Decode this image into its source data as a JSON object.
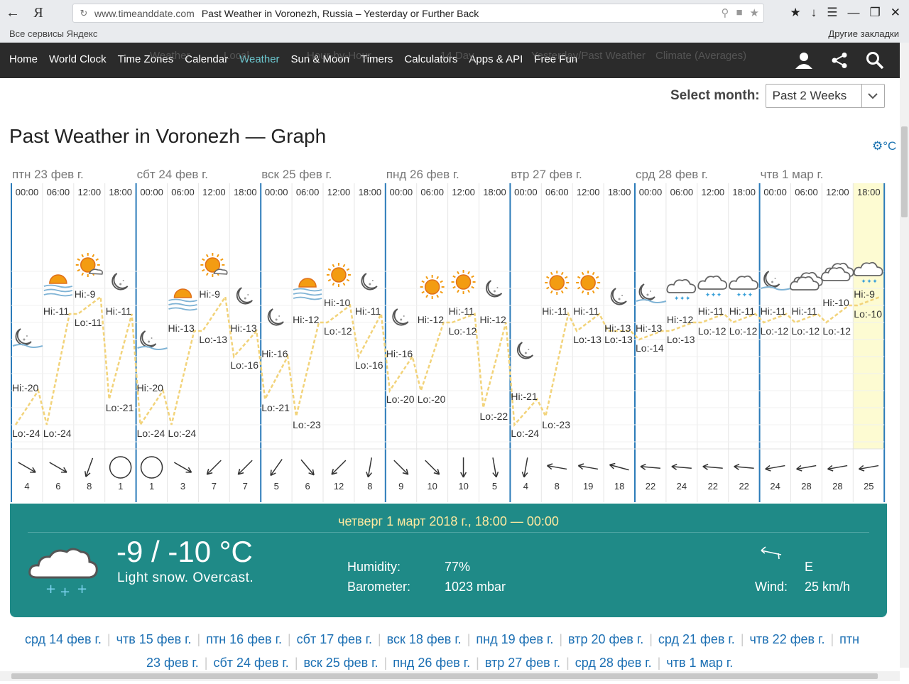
{
  "browser": {
    "url_domain": "www.timeanddate.com",
    "tab_title": "Past Weather in Voronezh, Russia – Yesterday or Further Back",
    "bookmarks_left": "Все сервисы Яндекс",
    "bookmarks_right": "Другие закладки"
  },
  "nav": {
    "items": [
      "Home",
      "World Clock",
      "Time Zones",
      "Calendar",
      "Weather",
      "Sun & Moon",
      "Timers",
      "Calculators",
      "Apps & API",
      "Free Fun"
    ],
    "active": "Weather",
    "subnav_ghost": [
      "Weather",
      "Local",
      "Hour-by-Hour",
      "14 Day",
      "Yesterday/Past Weather",
      "Climate (Averages)"
    ]
  },
  "month_select": {
    "label": "Select month:",
    "value": "Past 2 Weeks"
  },
  "page_title": "Past Weather in Voronezh — Graph",
  "unit_toggle": "°C",
  "graph": {
    "days": [
      "птн 23 фев г.",
      "сбт 24 фев г.",
      "вск 25 фев г.",
      "пнд 26 фев г.",
      "втр 27 фев г.",
      "срд 28 фев г.",
      "чтв 1 мар г."
    ],
    "hours": [
      "00:00",
      "06:00",
      "12:00",
      "18:00"
    ],
    "slots": [
      {
        "icon": "night-partly-cloudy",
        "hi": "Hi:-20",
        "lo": "Lo:-24",
        "wind_dir": 120,
        "wind": "4"
      },
      {
        "icon": "sunrise-fog",
        "hi": "Hi:-11",
        "lo": "Lo:-24",
        "wind_dir": 120,
        "wind": "6"
      },
      {
        "icon": "sun-cloud",
        "hi": "Hi:-9",
        "lo": "Lo:-11",
        "wind_dir": 200,
        "wind": "8"
      },
      {
        "icon": "moon",
        "hi": "Hi:-11",
        "lo": "Lo:-21",
        "wind_dir": -1,
        "wind": "1"
      },
      {
        "icon": "night-partly-cloudy",
        "hi": "Hi:-20",
        "lo": "Lo:-24",
        "wind_dir": -1,
        "wind": "1"
      },
      {
        "icon": "sunrise-fog",
        "hi": "Hi:-13",
        "lo": "Lo:-24",
        "wind_dir": 120,
        "wind": "3"
      },
      {
        "icon": "sun-cloud",
        "hi": "Hi:-9",
        "lo": "Lo:-13",
        "wind_dir": 225,
        "wind": "7"
      },
      {
        "icon": "moon",
        "hi": "Hi:-13",
        "lo": "Lo:-16",
        "wind_dir": 225,
        "wind": "7"
      },
      {
        "icon": "moon",
        "hi": "Hi:-16",
        "lo": "Lo:-21",
        "wind_dir": 215,
        "wind": "5"
      },
      {
        "icon": "sunrise-fog",
        "hi": "Hi:-12",
        "lo": "Lo:-23",
        "wind_dir": 140,
        "wind": "6"
      },
      {
        "icon": "sun",
        "hi": "Hi:-10",
        "lo": "Lo:-12",
        "wind_dir": 225,
        "wind": "12"
      },
      {
        "icon": "moon",
        "hi": "Hi:-11",
        "lo": "Lo:-16",
        "wind_dir": 190,
        "wind": "8"
      },
      {
        "icon": "moon",
        "hi": "Hi:-16",
        "lo": "Lo:-20",
        "wind_dir": 135,
        "wind": "9"
      },
      {
        "icon": "sun",
        "hi": "Hi:-12",
        "lo": "Lo:-20",
        "wind_dir": 135,
        "wind": "10"
      },
      {
        "icon": "sun",
        "hi": "Hi:-11",
        "lo": "Lo:-12",
        "wind_dir": 180,
        "wind": "10"
      },
      {
        "icon": "moon",
        "hi": "Hi:-12",
        "lo": "Lo:-22",
        "wind_dir": 170,
        "wind": "5"
      },
      {
        "icon": "moon",
        "hi": "Hi:-21",
        "lo": "Lo:-24",
        "wind_dir": 190,
        "wind": "4"
      },
      {
        "icon": "sun",
        "hi": "Hi:-11",
        "lo": "Lo:-23",
        "wind_dir": 280,
        "wind": "8"
      },
      {
        "icon": "sun",
        "hi": "Hi:-11",
        "lo": "Lo:-13",
        "wind_dir": 280,
        "wind": "19"
      },
      {
        "icon": "moon",
        "hi": "Hi:-13",
        "lo": "Lo:-13",
        "wind_dir": 285,
        "wind": "18"
      },
      {
        "icon": "night-partly-cloudy",
        "hi": "Hi:-13",
        "lo": "Lo:-14",
        "wind_dir": 275,
        "wind": "22"
      },
      {
        "icon": "light-snow",
        "hi": "Hi:-12",
        "lo": "Lo:-13",
        "wind_dir": 275,
        "wind": "24"
      },
      {
        "icon": "light-snow",
        "hi": "Hi:-11",
        "lo": "Lo:-12",
        "wind_dir": 275,
        "wind": "22"
      },
      {
        "icon": "light-snow",
        "hi": "Hi:-11",
        "lo": "Lo:-12",
        "wind_dir": 275,
        "wind": "22"
      },
      {
        "icon": "night-partly-cloudy",
        "hi": "Hi:-11",
        "lo": "Lo:-12",
        "wind_dir": 260,
        "wind": "24"
      },
      {
        "icon": "overcast",
        "hi": "Hi:-11",
        "lo": "Lo:-12",
        "wind_dir": 260,
        "wind": "28"
      },
      {
        "icon": "overcast",
        "hi": "Hi:-10",
        "lo": "Lo:-12",
        "wind_dir": 260,
        "wind": "28"
      },
      {
        "icon": "light-snow",
        "hi": "Hi:-9",
        "lo": "Lo:-10",
        "wind_dir": 260,
        "wind": "25"
      }
    ],
    "selected_slot": 27
  },
  "chart_data": {
    "type": "line",
    "title": "Past Weather in Voronezh — Graph",
    "x": [
      "00:00",
      "06:00",
      "12:00",
      "18:00",
      "00:00",
      "06:00",
      "12:00",
      "18:00",
      "00:00",
      "06:00",
      "12:00",
      "18:00",
      "00:00",
      "06:00",
      "12:00",
      "18:00",
      "00:00",
      "06:00",
      "12:00",
      "18:00",
      "00:00",
      "06:00",
      "12:00",
      "18:00",
      "00:00",
      "06:00",
      "12:00",
      "18:00"
    ],
    "series": [
      {
        "name": "Hi",
        "values": [
          -20,
          -11,
          -9,
          -11,
          -20,
          -13,
          -9,
          -13,
          -16,
          -12,
          -10,
          -11,
          -16,
          -12,
          -11,
          -12,
          -21,
          -11,
          -11,
          -13,
          -13,
          -12,
          -11,
          -11,
          -11,
          -11,
          -10,
          -9
        ]
      },
      {
        "name": "Lo",
        "values": [
          -24,
          -24,
          -11,
          -21,
          -24,
          -24,
          -13,
          -16,
          -21,
          -23,
          -12,
          -16,
          -20,
          -20,
          -12,
          -22,
          -24,
          -23,
          -13,
          -13,
          -14,
          -13,
          -12,
          -12,
          -12,
          -12,
          -12,
          -10
        ]
      }
    ],
    "ylim": [
      -26,
      -6
    ]
  },
  "detail": {
    "datetime": "четверг 1 март 2018 г., 18:00 — 00:00",
    "temp": "-9 / -10 °C",
    "condition": "Light snow. Overcast.",
    "humidity_label": "Humidity:",
    "humidity": "77%",
    "barometer_label": "Barometer:",
    "barometer": "1023 mbar",
    "wind_dir_text": "E",
    "wind_label": "Wind:",
    "wind": "25 km/h"
  },
  "day_links": {
    "row1": [
      "срд 14 фев г.",
      "чтв 15 фев г.",
      "птн 16 фев г.",
      "сбт 17 фев г.",
      "вск 18 фев г.",
      "пнд 19 фев г.",
      "втр 20 фев г.",
      "срд 21 фев г.",
      "чтв 22 фев г.",
      "птн"
    ],
    "row2": [
      "23 фев г.",
      "сбт 24 фев г.",
      "вск 25 фев г.",
      "пнд 26 фев г.",
      "втр 27 фев г.",
      "срд 28 фев г.",
      "чтв 1 мар г."
    ]
  },
  "colors": {
    "accent": "#1f8a87",
    "line": "#f2d37a",
    "day_rule": "#2b7bb9",
    "highlight": "#fdfbd2",
    "nav_bg": "#2b2b2b"
  }
}
